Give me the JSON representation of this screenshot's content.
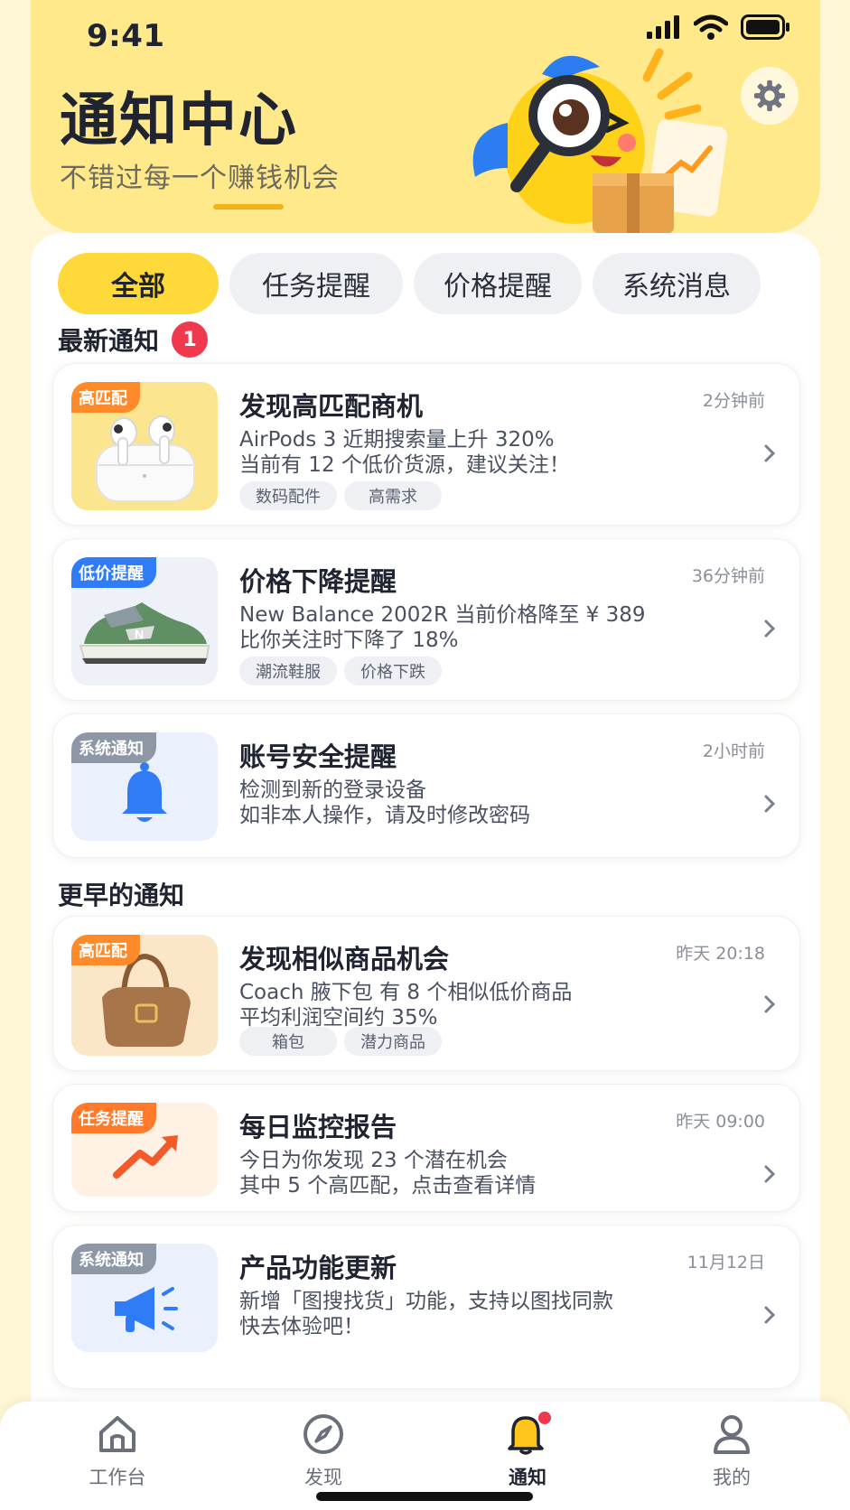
{
  "status_bar": {
    "time": "9:41"
  },
  "header": {
    "title": "通知中心",
    "subtitle": "不错过每一个赚钱机会"
  },
  "tabs": [
    {
      "label": "全部",
      "active": true
    },
    {
      "label": "任务提醒",
      "active": false
    },
    {
      "label": "价格提醒",
      "active": false
    },
    {
      "label": "系统消息",
      "active": false
    }
  ],
  "sections": {
    "latest": {
      "title": "最新通知",
      "badge": "1"
    },
    "earlier": {
      "title": "更早的通知"
    }
  },
  "notifications": [
    {
      "tag": "高匹配",
      "title": "发现高匹配商机",
      "time": "2分钟前",
      "line1": "AirPods 3 近期搜索量上升 320%",
      "line2": "当前有 12 个低价货源，建议关注！",
      "chips": [
        "数码配件",
        "高需求"
      ],
      "icon": "airpods-image"
    },
    {
      "tag": "低价提醒",
      "title": "价格下降提醒",
      "time": "36分钟前",
      "line1": "New Balance 2002R 当前价格降至 ¥ 389",
      "line2": "比你关注时下降了 18%",
      "chips": [
        "潮流鞋服",
        "价格下跌"
      ],
      "icon": "sneaker-image"
    },
    {
      "tag": "系统通知",
      "title": "账号安全提醒",
      "time": "2小时前",
      "line1": "检测到新的登录设备",
      "line2": "如非本人操作，请及时修改密码",
      "chips": [],
      "icon": "bell-icon"
    },
    {
      "tag": "高匹配",
      "title": "发现相似商品机会",
      "time": "昨天 20:18",
      "line1": "Coach 腋下包 有 8 个相似低价商品",
      "line2": "平均利润空间约 35%",
      "chips": [
        "箱包",
        "潜力商品"
      ],
      "icon": "handbag-image"
    },
    {
      "tag": "任务提醒",
      "title": "每日监控报告",
      "time": "昨天 09:00",
      "line1": "今日为你发现 23 个潜在机会",
      "line2": "其中 5 个高匹配，点击查看详情",
      "chips": [],
      "icon": "trend-up-icon"
    },
    {
      "tag": "系统通知",
      "title": "产品功能更新",
      "time": "11月12日",
      "line1": "新增「图搜找货」功能，支持以图找同款",
      "line2": "快去体验吧！",
      "chips": [],
      "icon": "megaphone-icon"
    }
  ],
  "bottom_nav": [
    {
      "label": "工作台",
      "icon": "home-icon",
      "active": false
    },
    {
      "label": "发现",
      "icon": "compass-icon",
      "active": false
    },
    {
      "label": "通知",
      "icon": "bell-icon",
      "active": true
    },
    {
      "label": "我的",
      "icon": "user-icon",
      "active": false
    }
  ],
  "colors": {
    "accent": "#ffd83a",
    "header_bg": "#ffe98a",
    "badge_red": "#f0384e",
    "tag_orange": "#ff8a2a",
    "tag_blue": "#2f7cf6",
    "tag_gray": "#8e97a6"
  }
}
